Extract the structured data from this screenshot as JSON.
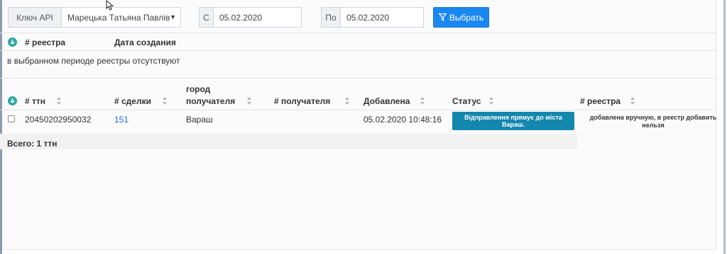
{
  "filters": {
    "api_key_label": "Ключ API",
    "api_key_value": "Марецька Татьяна Павлів",
    "from_label": "С",
    "from_value": "05.02.2020",
    "to_label": "По",
    "to_value": "05.02.2020",
    "select_button": "Выбрать"
  },
  "registry_table": {
    "columns": [
      "# реестра",
      "Дата создания"
    ],
    "empty_message": "в выбранном периоде реестры отсутствуют"
  },
  "ttn_table": {
    "columns": {
      "ttn": "# ттн",
      "deal": "# сделки",
      "city_line1": "город",
      "city_line2": "получателя",
      "recipient": "# получателя",
      "added": "Добавлена",
      "status": "Статус",
      "registry": "# реестра"
    },
    "rows": [
      {
        "ttn": "20450202950032",
        "deal": "151",
        "city": "Вараш",
        "recipient": "",
        "added": "05.02.2020 10:48:16",
        "status": "Відправлення прямує до міста Вараш.",
        "registry": "добавлена вручную, в реестр добавить нельзя"
      }
    ],
    "total": "Всего: 1 ттн"
  },
  "colors": {
    "primary_button": "#1a88f0",
    "status_badge": "#1387ad",
    "sort_icon": "#2ea8a0",
    "link": "#1a73c9"
  }
}
